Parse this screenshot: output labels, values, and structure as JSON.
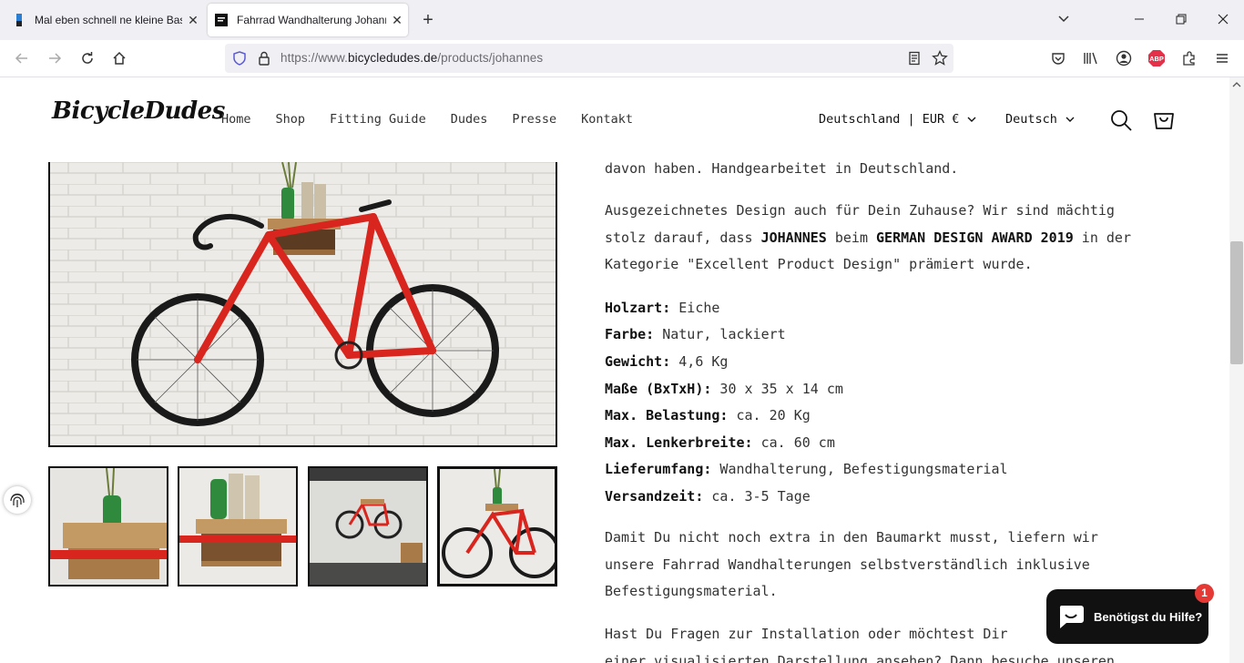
{
  "browser": {
    "tabs": [
      {
        "title": "Mal eben schnell ne kleine Bastelei",
        "active": false
      },
      {
        "title": "Fahrrad Wandhalterung Johannes",
        "active": true
      }
    ],
    "url_prefix": "https://www.",
    "url_domain": "bicycledudes.de",
    "url_path": "/products/johannes",
    "addon_badge": "ABP"
  },
  "site": {
    "logo": "BicycleDudes",
    "nav": [
      "Home",
      "Shop",
      "Fitting Guide",
      "Dudes",
      "Presse",
      "Kontakt"
    ],
    "country_currency": "Deutschland | EUR €",
    "language": "Deutsch"
  },
  "description": {
    "para0_line": "davon haben. Handgearbeitet in Deutschland.",
    "para1": {
      "line1": "Ausgezeichnetes Design auch für Dein Zuhause? Wir sind mächtig",
      "line2_a": "stolz darauf, dass ",
      "line2_b": "JOHANNES",
      "line2_c": " beim ",
      "line2_d": "GERMAN DESIGN AWARD 2019",
      "line2_e": " in der",
      "line3": "Kategorie \"Excellent Product Design\" prämiert wurde."
    },
    "specs": [
      {
        "label": "Holzart:",
        "value": " Eiche"
      },
      {
        "label": "Farbe:",
        "value": " Natur, lackiert"
      },
      {
        "label": "Gewicht:",
        "value": " 4,6 Kg"
      },
      {
        "label": "Maße (BxTxH):",
        "value": " 30 x 35 x 14 cm"
      },
      {
        "label": "Max. Belastung:",
        "value": " ca. 20 Kg"
      },
      {
        "label": "Max. Lenkerbreite:",
        "value": " ca. 60 cm"
      },
      {
        "label": "Lieferumfang:",
        "value": " Wandhalterung, Befestigungsmaterial"
      },
      {
        "label": "Versandzeit:",
        "value": " ca. 3-5 Tage"
      }
    ],
    "para2": [
      "Damit Du nicht noch extra in den Baumarkt musst, liefern wir",
      "unsere Fahrrad Wandhalterungen selbstverständlich inklusive",
      "Befestigungsmaterial."
    ],
    "para3": [
      "Hast Du Fragen zur Installation oder möchtest Dir",
      "einer visualisierten Darstellung ansehen? Dann besuche unseren"
    ]
  },
  "chat": {
    "label": "Benötigst du Hilfe?",
    "badge": "1"
  },
  "colors": {
    "bike_red": "#d8261f",
    "wood": "#b88a55",
    "chat_bg": "#111111",
    "badge_red": "#e53935"
  }
}
